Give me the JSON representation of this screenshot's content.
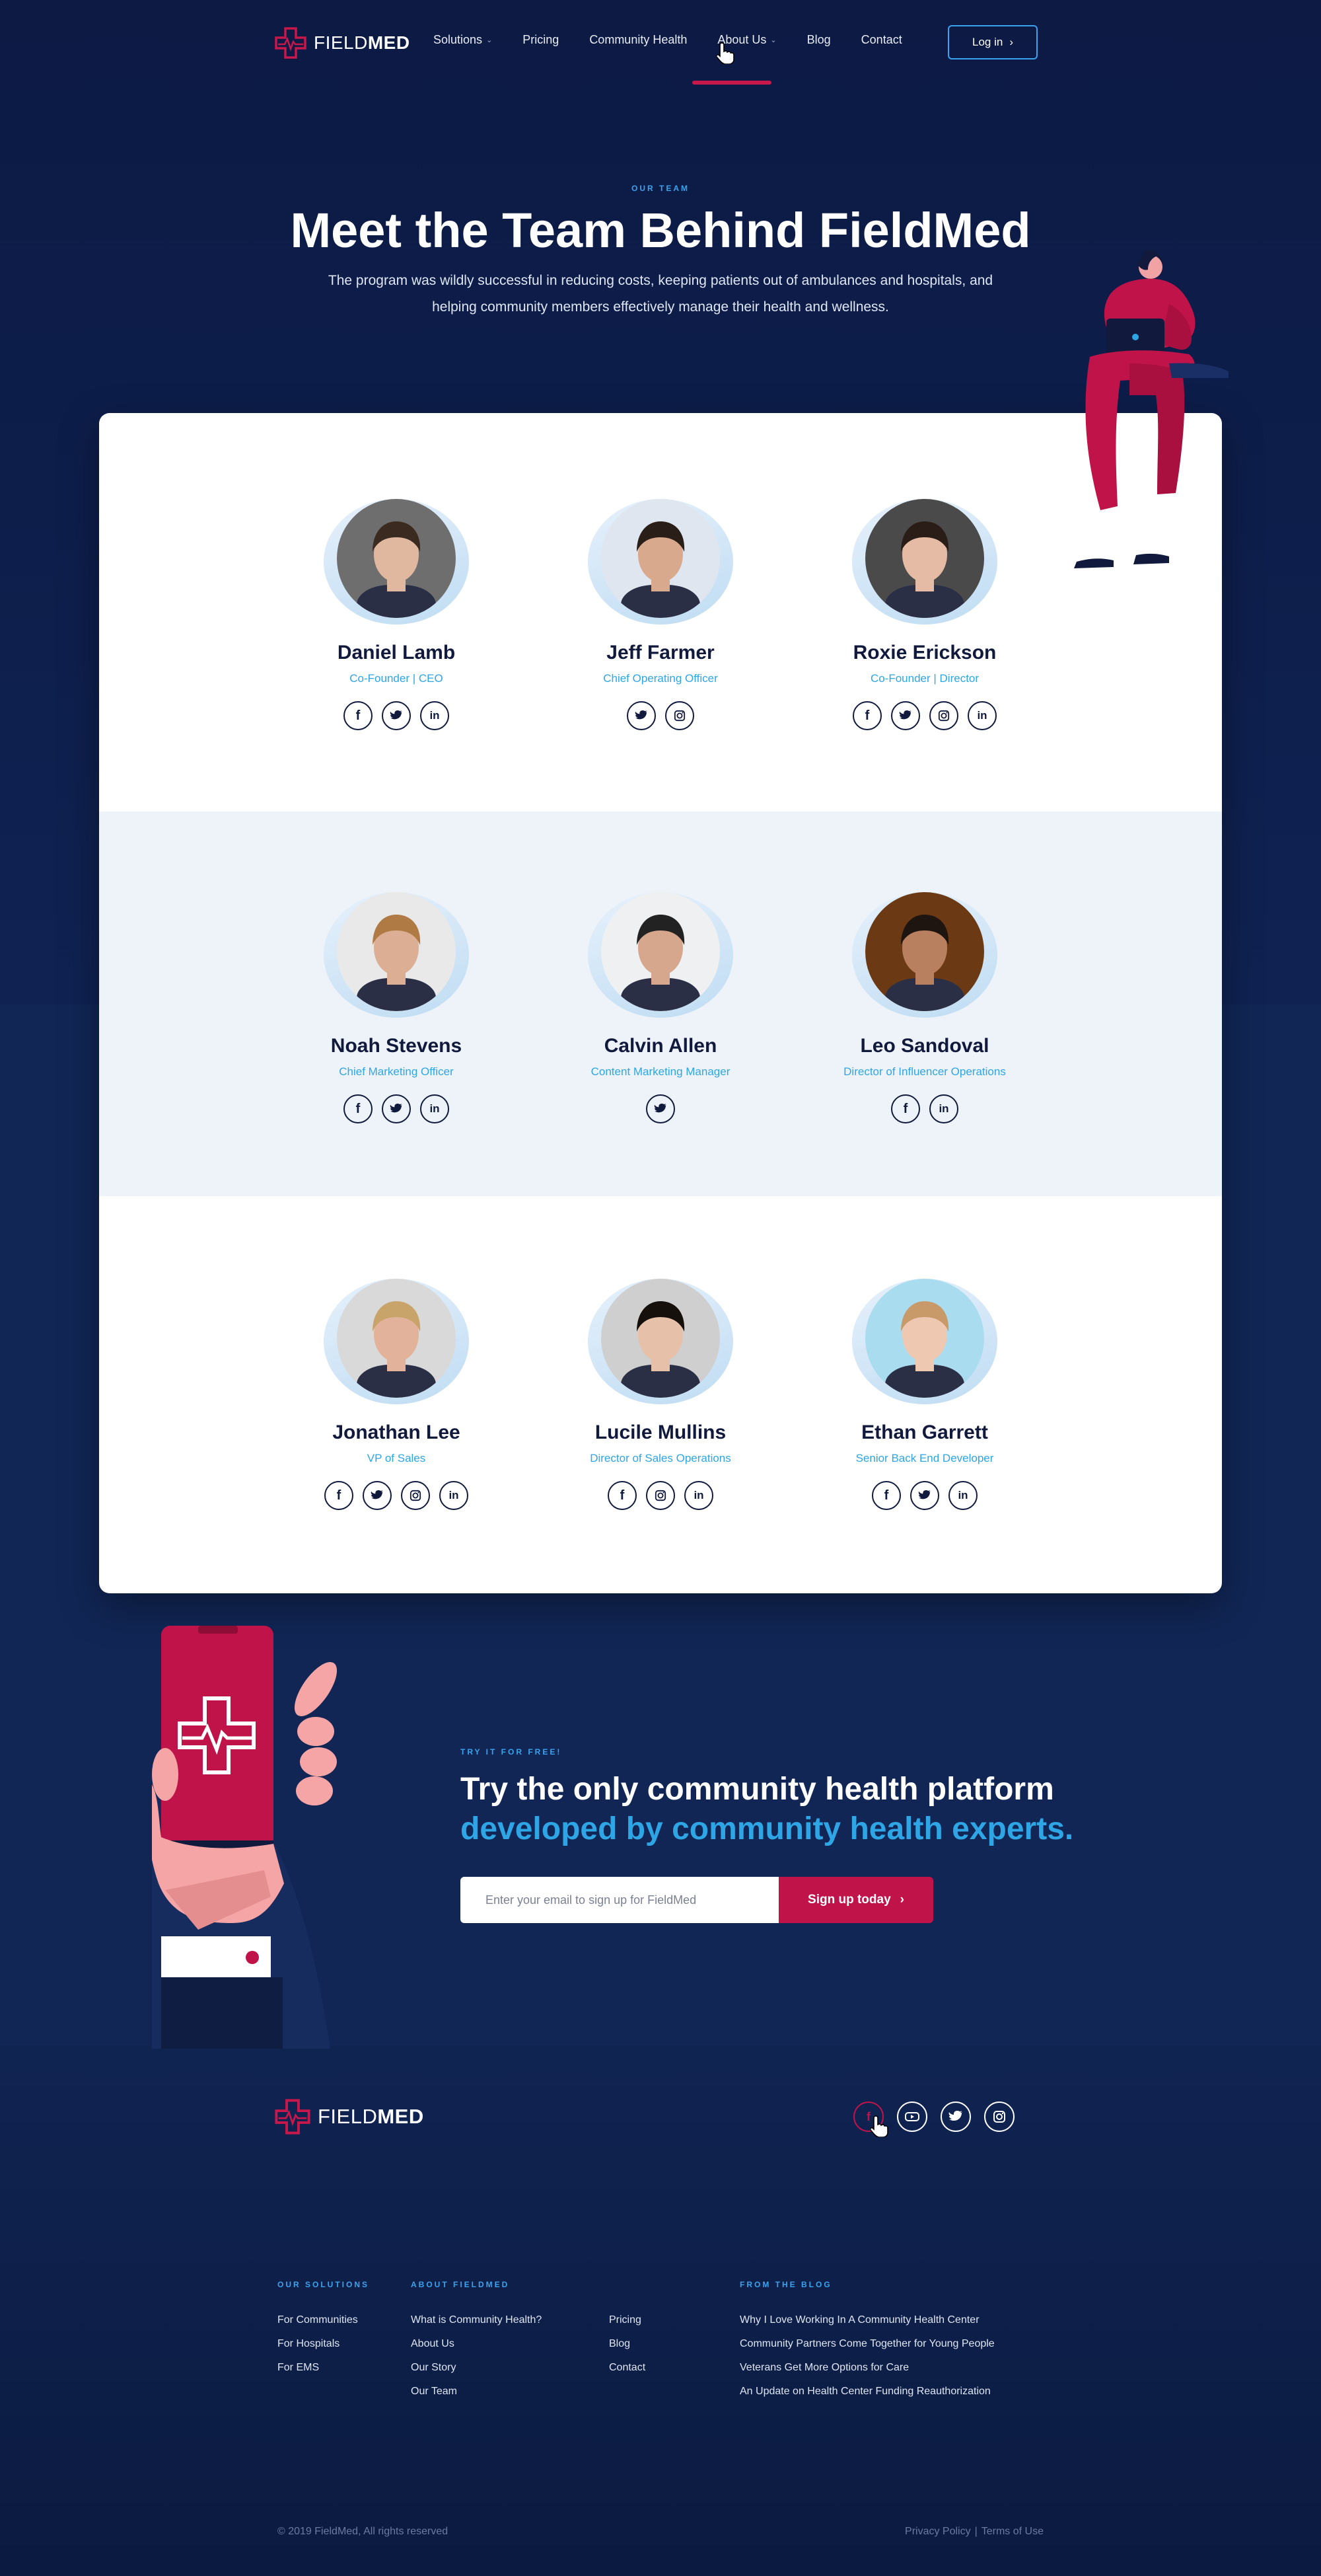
{
  "brand": {
    "logo_light": "FIELD",
    "logo_bold": "MED",
    "accent": "#c8174a",
    "blue": "#2ea6e6",
    "navy": "#0e1e4a"
  },
  "nav": {
    "items": [
      {
        "label": "Solutions",
        "dropdown": true
      },
      {
        "label": "Pricing",
        "dropdown": false
      },
      {
        "label": "Community Health",
        "dropdown": false
      },
      {
        "label": "About Us",
        "dropdown": true,
        "active": true
      },
      {
        "label": "Blog",
        "dropdown": false
      },
      {
        "label": "Contact",
        "dropdown": false
      }
    ],
    "login_label": "Log in",
    "login_chevron": "›"
  },
  "hero": {
    "eyebrow": "OUR TEAM",
    "title": "Meet the Team Behind FieldMed",
    "description": "The program was wildly successful in reducing costs, keeping patients out of ambulances and hospitals, and helping community members effectively manage their health and wellness."
  },
  "team": [
    {
      "name": "Daniel Lamb",
      "role": "Co-Founder | CEO",
      "socials": [
        "facebook-icon",
        "twitter-icon",
        "linkedin-icon"
      ]
    },
    {
      "name": "Jeff Farmer",
      "role": "Chief Operating Officer",
      "socials": [
        "twitter-icon",
        "instagram-icon"
      ]
    },
    {
      "name": "Roxie Erickson",
      "role": "Co-Founder | Director",
      "socials": [
        "facebook-icon",
        "twitter-icon",
        "instagram-icon",
        "linkedin-icon"
      ]
    },
    {
      "name": "Noah Stevens",
      "role": "Chief Marketing Officer",
      "socials": [
        "facebook-icon",
        "twitter-icon",
        "linkedin-icon"
      ]
    },
    {
      "name": "Calvin Allen",
      "role": "Content Marketing Manager",
      "socials": [
        "twitter-icon"
      ]
    },
    {
      "name": "Leo Sandoval",
      "role": "Director of Influencer Operations",
      "socials": [
        "facebook-icon",
        "linkedin-icon"
      ]
    },
    {
      "name": "Jonathan Lee",
      "role": "VP of Sales",
      "socials": [
        "facebook-icon",
        "twitter-icon",
        "instagram-icon",
        "linkedin-icon"
      ]
    },
    {
      "name": "Lucile Mullins",
      "role": "Director of Sales Operations",
      "socials": [
        "facebook-icon",
        "instagram-icon",
        "linkedin-icon"
      ]
    },
    {
      "name": "Ethan Garrett",
      "role": "Senior Back End Developer",
      "socials": [
        "facebook-icon",
        "twitter-icon",
        "linkedin-icon"
      ]
    }
  ],
  "cta": {
    "eyebrow": "TRY IT FOR FREE!",
    "line1": "Try the only community health platform",
    "line2": "developed by community health experts.",
    "email_placeholder": "Enter your email to sign up for FieldMed",
    "button_label": "Sign up today",
    "button_chevron": "›"
  },
  "footer": {
    "socials": [
      "facebook-icon",
      "youtube-icon",
      "twitter-icon",
      "instagram-icon"
    ],
    "columns": [
      {
        "heading": "OUR SOLUTIONS",
        "links": [
          "For Communities",
          "For Hospitals",
          "For EMS"
        ]
      },
      {
        "heading": "ABOUT FIELDMED",
        "links": [
          "What is Community Health?",
          "About Us",
          "Our Story",
          "Our Team"
        ]
      },
      {
        "heading": "",
        "links": [
          "Pricing",
          "Blog",
          "Contact"
        ]
      },
      {
        "heading": "FROM THE BLOG",
        "links": [
          "Why I Love Working In A Community Health Center",
          "Community Partners Come Together for Young People",
          "Veterans Get More Options for Care",
          "An Update on Health Center Funding Reauthorization"
        ]
      }
    ],
    "copyright": "© 2019 FieldMed, All rights reserved",
    "privacy": "Privacy Policy",
    "separator": "|",
    "terms": "Terms of Use"
  }
}
